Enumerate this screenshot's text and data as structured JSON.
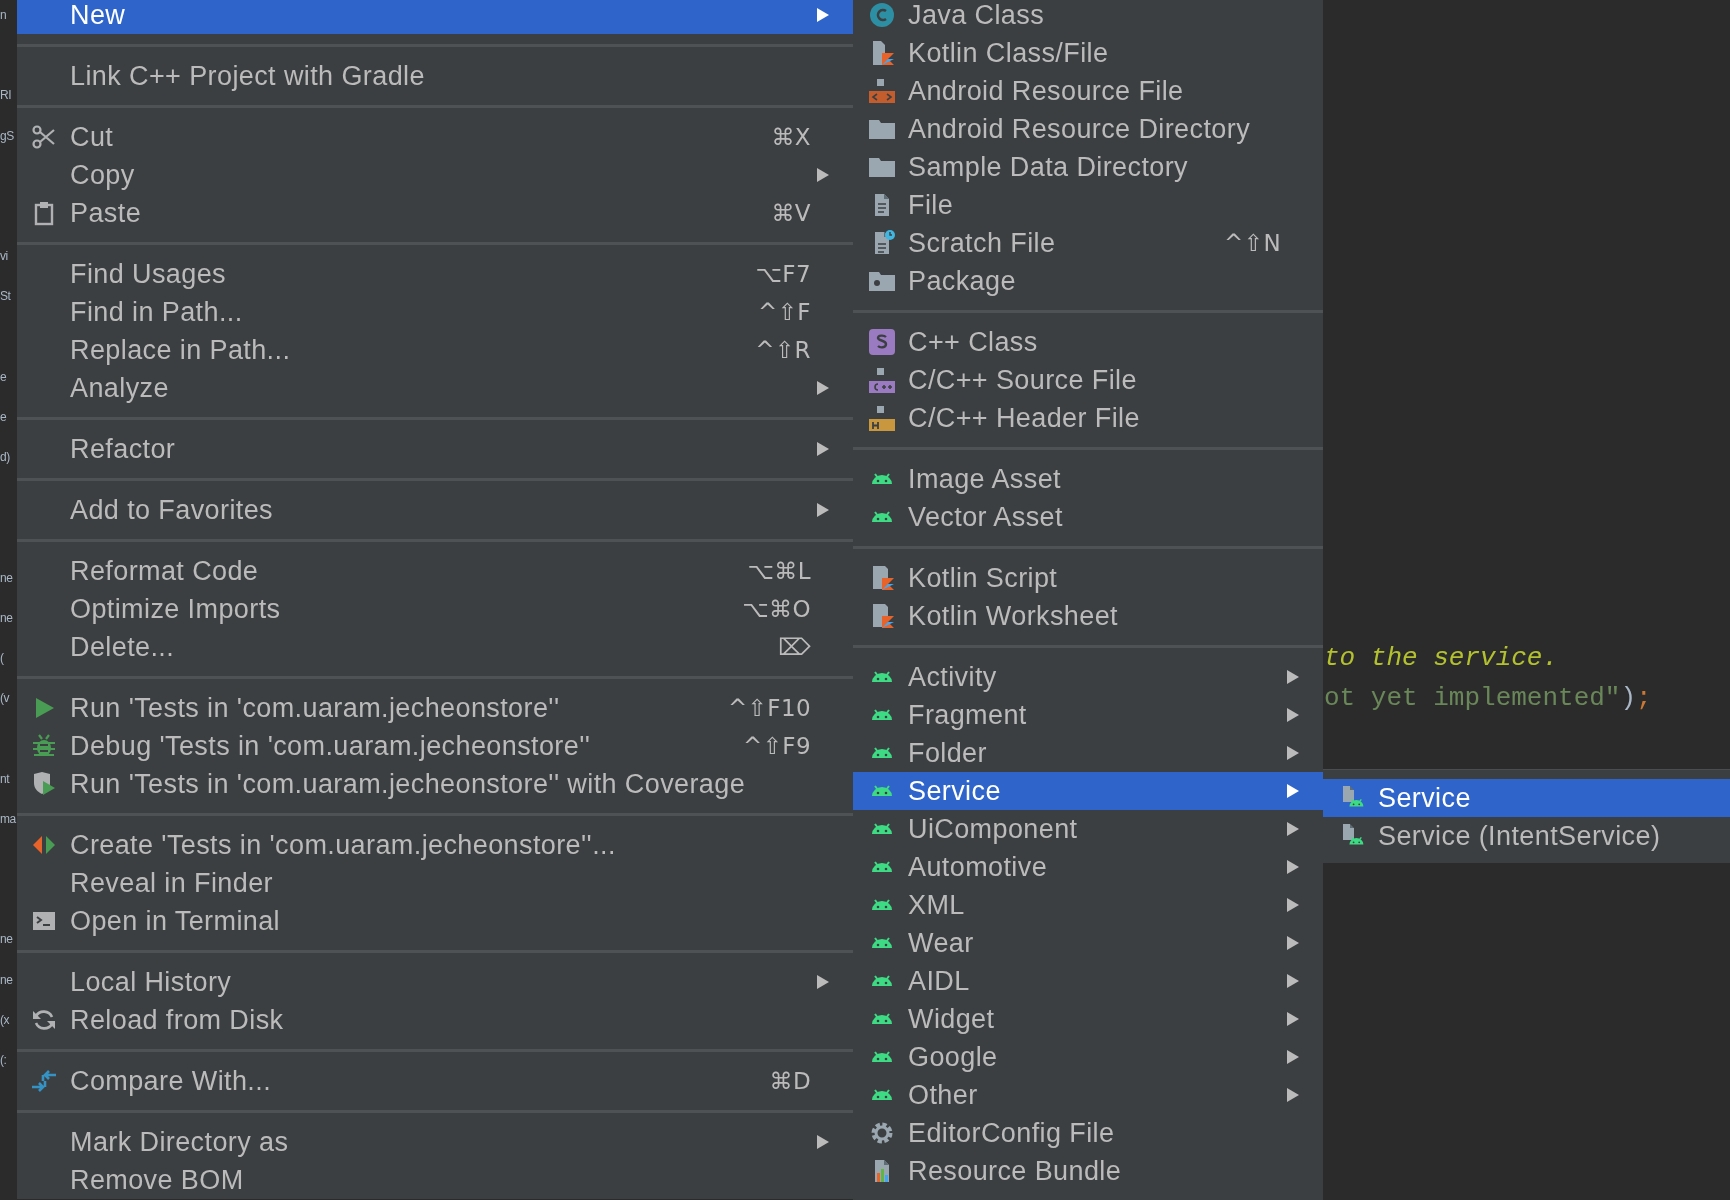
{
  "editor": {
    "left_fragments": [
      "n",
      "RI",
      "gS",
      "vi",
      "St",
      "e",
      "e",
      "d)",
      "ne",
      "ne",
      "(",
      "(v",
      "nt",
      "ma",
      "ne",
      "ne",
      "(x",
      "(:"
    ],
    "code_lines": [
      [
        {
          "kind": "comment",
          "text": "to the service."
        }
      ],
      [
        {
          "kind": "string",
          "text": "ot yet implemented\""
        },
        {
          "kind": "paren",
          "text": ")"
        },
        {
          "kind": "semicolon",
          "text": ";"
        }
      ]
    ]
  },
  "menus": [
    {
      "groups": [
        [
          {
            "label": "New",
            "submenu": true,
            "selected": true
          }
        ],
        [
          {
            "label": "Link C++ Project with Gradle",
            "submenu": false,
            "selected": false
          }
        ],
        [
          {
            "label": "Cut",
            "shortcut": "⌘X",
            "submenu": false,
            "selected": false
          },
          {
            "label": "Copy",
            "submenu": true,
            "selected": false
          },
          {
            "label": "Paste",
            "shortcut": "⌘V",
            "submenu": false,
            "selected": false
          }
        ],
        [
          {
            "label": "Find Usages",
            "shortcut": "⌥F7",
            "submenu": false,
            "selected": false
          },
          {
            "label": "Find in Path...",
            "shortcut": "^⇧F",
            "submenu": false,
            "selected": false
          },
          {
            "label": "Replace in Path...",
            "shortcut": "^⇧R",
            "submenu": false,
            "selected": false
          },
          {
            "label": "Analyze",
            "submenu": true,
            "selected": false
          }
        ],
        [
          {
            "label": "Refactor",
            "submenu": true,
            "selected": false
          }
        ],
        [
          {
            "label": "Add to Favorites",
            "submenu": true,
            "selected": false
          }
        ],
        [
          {
            "label": "Reformat Code",
            "shortcut": "⌥⌘L",
            "submenu": false,
            "selected": false
          },
          {
            "label": "Optimize Imports",
            "shortcut": "⌥⌘O",
            "submenu": false,
            "selected": false
          },
          {
            "label": "Delete...",
            "shortcut": "⌦",
            "submenu": false,
            "selected": false
          }
        ],
        [
          {
            "label": "Run 'Tests in 'com.uaram.jecheonstore''",
            "shortcut": "^⇧F10",
            "submenu": false,
            "selected": false
          },
          {
            "label": "Debug 'Tests in 'com.uaram.jecheonstore''",
            "shortcut": "^⇧F9",
            "submenu": false,
            "selected": false
          },
          {
            "label": "Run 'Tests in 'com.uaram.jecheonstore'' with Coverage",
            "submenu": false,
            "selected": false
          }
        ],
        [
          {
            "label": "Create 'Tests in 'com.uaram.jecheonstore''...",
            "submenu": false,
            "selected": false
          },
          {
            "label": "Reveal in Finder",
            "submenu": false,
            "selected": false
          },
          {
            "label": "Open in Terminal",
            "submenu": false,
            "selected": false
          }
        ],
        [
          {
            "label": "Local History",
            "submenu": true,
            "selected": false
          },
          {
            "label": "Reload from Disk",
            "submenu": false,
            "selected": false
          }
        ],
        [
          {
            "label": "Compare With...",
            "shortcut": "⌘D",
            "submenu": false,
            "selected": false
          }
        ],
        [
          {
            "label": "Mark Directory as",
            "submenu": true,
            "selected": false
          },
          {
            "label": "Remove BOM",
            "submenu": false,
            "selected": false
          }
        ]
      ]
    },
    {
      "groups": [
        [
          {
            "label": "Java Class",
            "submenu": false,
            "selected": false
          },
          {
            "label": "Kotlin Class/File",
            "submenu": false,
            "selected": false
          },
          {
            "label": "Android Resource File",
            "submenu": false,
            "selected": false
          },
          {
            "label": "Android Resource Directory",
            "submenu": false,
            "selected": false
          },
          {
            "label": "Sample Data Directory",
            "submenu": false,
            "selected": false
          },
          {
            "label": "File",
            "submenu": false,
            "selected": false
          },
          {
            "label": "Scratch File",
            "shortcut": "^⇧N",
            "submenu": false,
            "selected": false
          },
          {
            "label": "Package",
            "submenu": false,
            "selected": false
          }
        ],
        [
          {
            "label": "C++ Class",
            "submenu": false,
            "selected": false
          },
          {
            "label": "C/C++ Source File",
            "submenu": false,
            "selected": false
          },
          {
            "label": "C/C++ Header File",
            "submenu": false,
            "selected": false
          }
        ],
        [
          {
            "label": "Image Asset",
            "submenu": false,
            "selected": false
          },
          {
            "label": "Vector Asset",
            "submenu": false,
            "selected": false
          }
        ],
        [
          {
            "label": "Kotlin Script",
            "submenu": false,
            "selected": false
          },
          {
            "label": "Kotlin Worksheet",
            "submenu": false,
            "selected": false
          }
        ],
        [
          {
            "label": "Activity",
            "submenu": true,
            "selected": false
          },
          {
            "label": "Fragment",
            "submenu": true,
            "selected": false
          },
          {
            "label": "Folder",
            "submenu": true,
            "selected": false
          },
          {
            "label": "Service",
            "submenu": true,
            "selected": true
          },
          {
            "label": "UiComponent",
            "submenu": true,
            "selected": false
          },
          {
            "label": "Automotive",
            "submenu": true,
            "selected": false
          },
          {
            "label": "XML",
            "submenu": true,
            "selected": false
          },
          {
            "label": "Wear",
            "submenu": true,
            "selected": false
          },
          {
            "label": "AIDL",
            "submenu": true,
            "selected": false
          },
          {
            "label": "Widget",
            "submenu": true,
            "selected": false
          },
          {
            "label": "Google",
            "submenu": true,
            "selected": false
          },
          {
            "label": "Other",
            "submenu": true,
            "selected": false
          },
          {
            "label": "EditorConfig File",
            "submenu": false,
            "selected": false
          },
          {
            "label": "Resource Bundle",
            "submenu": false,
            "selected": false
          }
        ]
      ]
    },
    {
      "groups": [
        [
          {
            "label": "Service",
            "submenu": false,
            "selected": true
          },
          {
            "label": "Service (IntentService)",
            "submenu": false,
            "selected": false
          }
        ]
      ]
    }
  ]
}
